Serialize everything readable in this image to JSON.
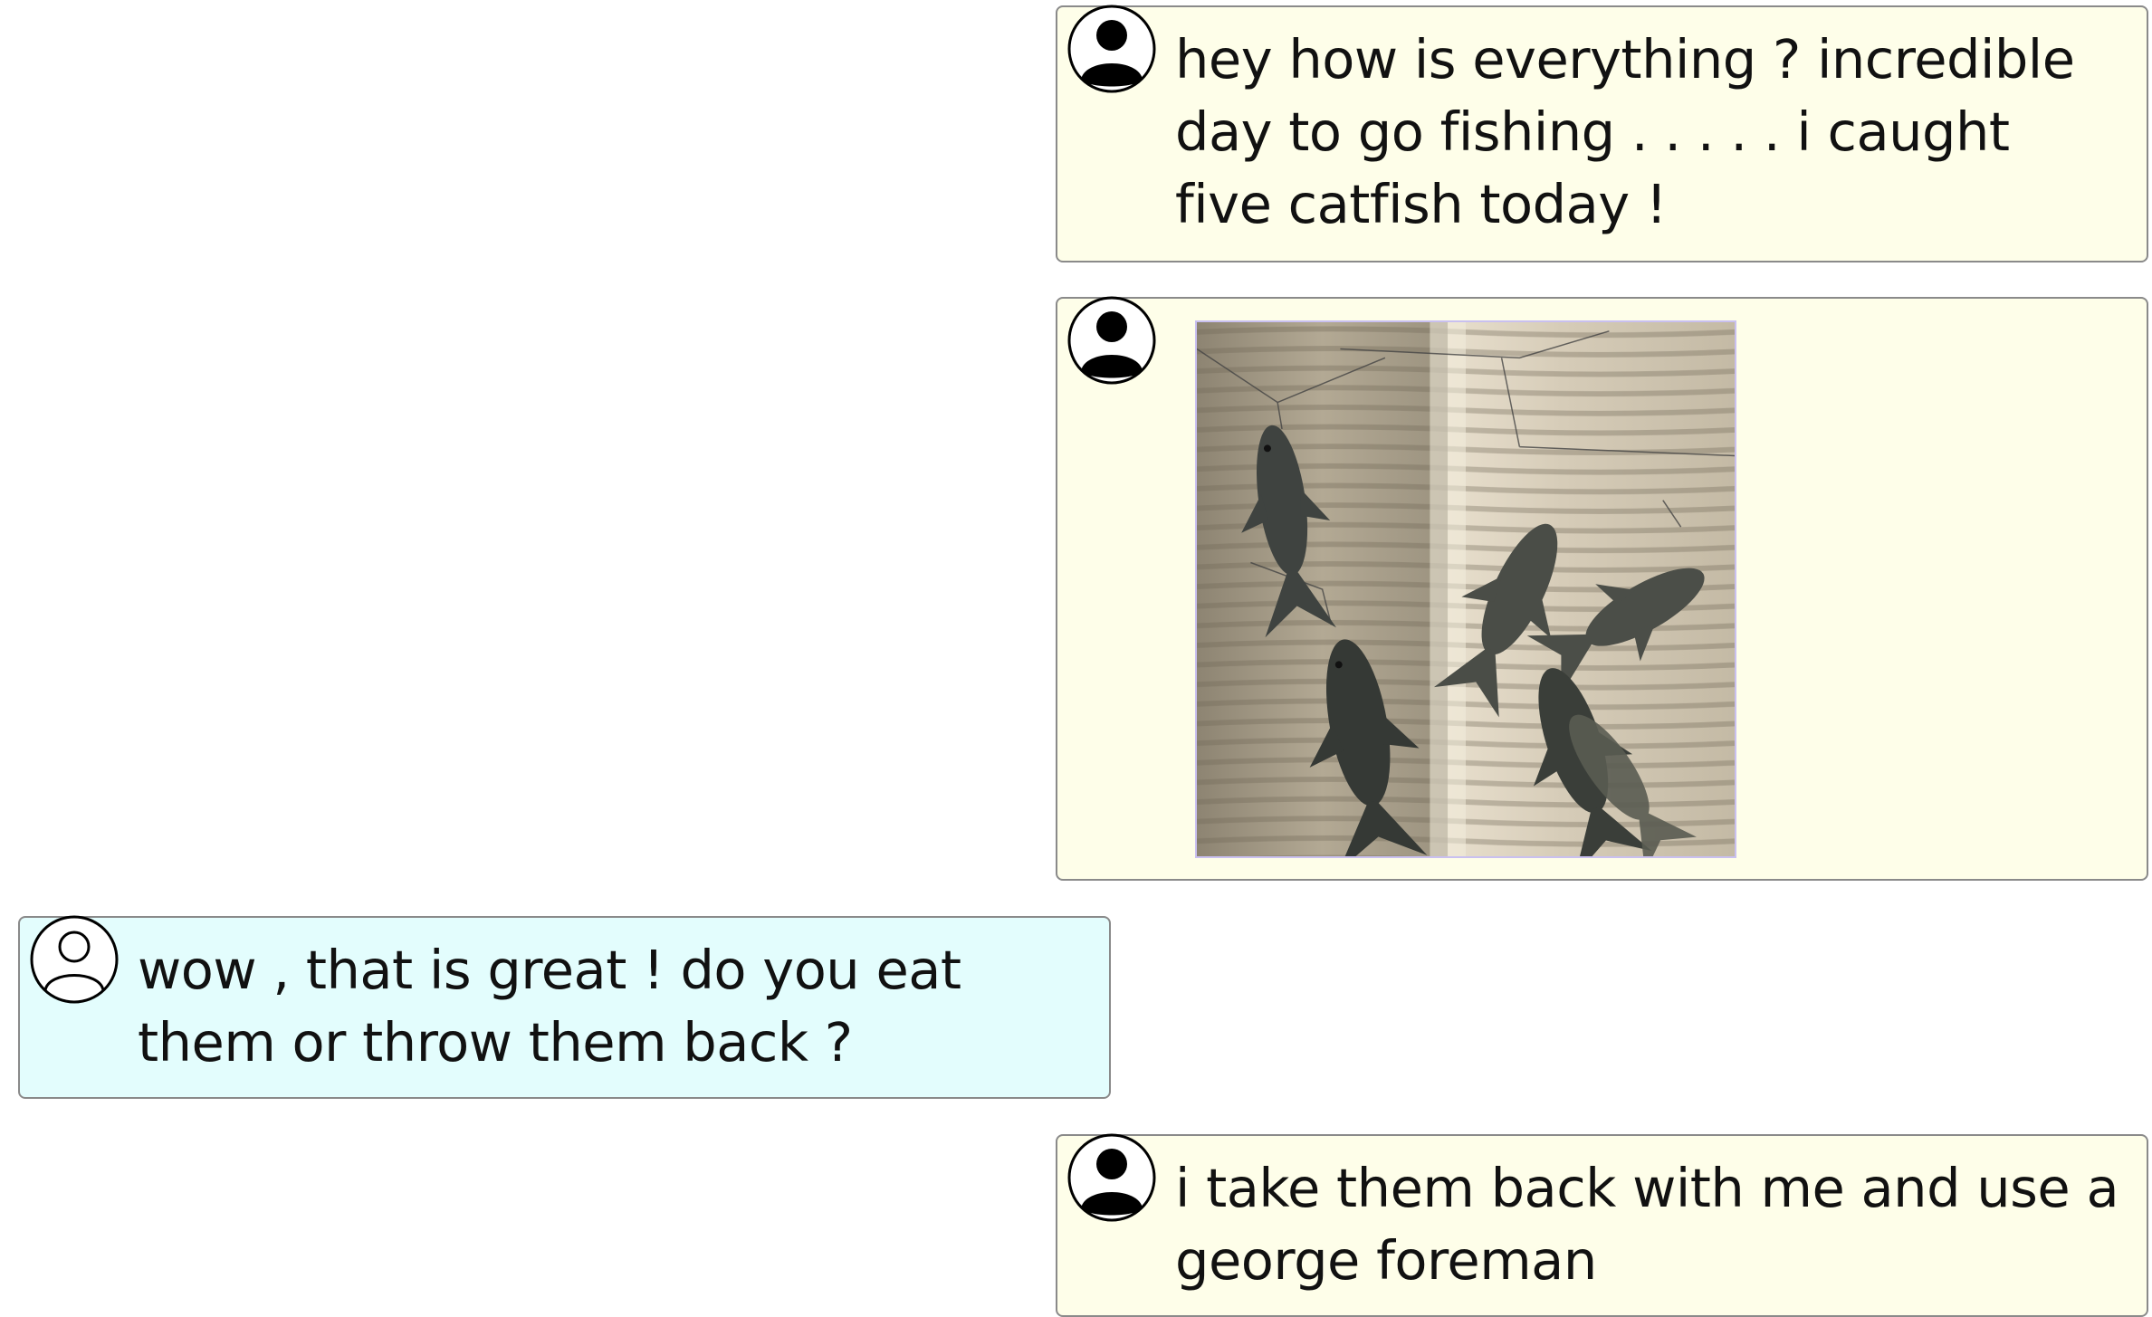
{
  "conversation": {
    "messages": [
      {
        "sender": "me",
        "avatar_icon": "user-filled-icon",
        "text": "hey how is everything ? incredible day to go fishing . . . . . i caught five catfish today !"
      },
      {
        "sender": "me",
        "avatar_icon": "user-filled-icon",
        "image_icon": "catfish-photo"
      },
      {
        "sender": "them",
        "avatar_icon": "user-outline-icon",
        "text": "wow , that is great ! do you eat them or throw them back ?"
      },
      {
        "sender": "me",
        "avatar_icon": "user-filled-icon",
        "text": "i take them back with me and use a george foreman"
      }
    ]
  },
  "colors": {
    "me_bubble": "#fefee9",
    "them_bubble": "#e3fdfd",
    "border": "#8a8a8a"
  }
}
